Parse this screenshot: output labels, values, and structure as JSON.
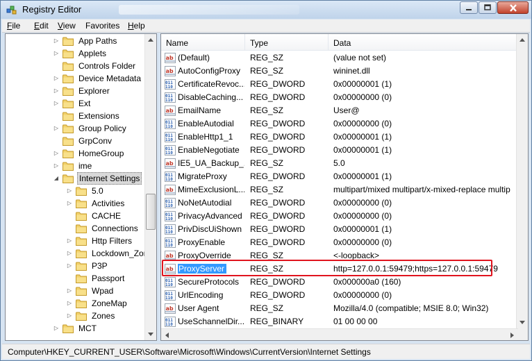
{
  "window": {
    "title": "Registry Editor"
  },
  "menu": [
    {
      "label": "File",
      "ul": "F",
      "rest": "ile"
    },
    {
      "label": "Edit",
      "ul": "E",
      "rest": "dit"
    },
    {
      "label": "View",
      "ul": "V",
      "rest": "iew"
    },
    {
      "label": "Favorites",
      "ul": "",
      "rest": "Favorites"
    },
    {
      "label": "Help",
      "ul": "H",
      "rest": "elp"
    }
  ],
  "tree": [
    {
      "label": "App Paths",
      "level": 0,
      "expander": "collapsed"
    },
    {
      "label": "Applets",
      "level": 0,
      "expander": "collapsed"
    },
    {
      "label": "Controls Folder",
      "level": 0,
      "expander": "none"
    },
    {
      "label": "Device Metadata",
      "level": 0,
      "expander": "collapsed"
    },
    {
      "label": "Explorer",
      "level": 0,
      "expander": "collapsed"
    },
    {
      "label": "Ext",
      "level": 0,
      "expander": "collapsed"
    },
    {
      "label": "Extensions",
      "level": 0,
      "expander": "none"
    },
    {
      "label": "Group Policy",
      "level": 0,
      "expander": "collapsed"
    },
    {
      "label": "GrpConv",
      "level": 0,
      "expander": "none"
    },
    {
      "label": "HomeGroup",
      "level": 0,
      "expander": "collapsed"
    },
    {
      "label": "ime",
      "level": 0,
      "expander": "collapsed"
    },
    {
      "label": "Internet Settings",
      "level": 0,
      "expander": "expanded",
      "selected": true
    },
    {
      "label": "5.0",
      "level": 1,
      "expander": "collapsed"
    },
    {
      "label": "Activities",
      "level": 1,
      "expander": "collapsed"
    },
    {
      "label": "CACHE",
      "level": 1,
      "expander": "none"
    },
    {
      "label": "Connections",
      "level": 1,
      "expander": "none"
    },
    {
      "label": "Http Filters",
      "level": 1,
      "expander": "collapsed"
    },
    {
      "label": "Lockdown_Zor",
      "level": 1,
      "expander": "collapsed"
    },
    {
      "label": "P3P",
      "level": 1,
      "expander": "collapsed"
    },
    {
      "label": "Passport",
      "level": 1,
      "expander": "none"
    },
    {
      "label": "Wpad",
      "level": 1,
      "expander": "collapsed"
    },
    {
      "label": "ZoneMap",
      "level": 1,
      "expander": "collapsed"
    },
    {
      "label": "Zones",
      "level": 1,
      "expander": "collapsed"
    },
    {
      "label": "MCT",
      "level": 0,
      "expander": "collapsed"
    }
  ],
  "columns": [
    "Name",
    "Type",
    "Data"
  ],
  "values": [
    {
      "icon": "string-value-icon",
      "name": "(Default)",
      "type": "REG_SZ",
      "data": "(value not set)"
    },
    {
      "icon": "string-value-icon",
      "name": "AutoConfigProxy",
      "type": "REG_SZ",
      "data": "wininet.dll"
    },
    {
      "icon": "binary-value-icon",
      "name": "CertificateRevoc...",
      "type": "REG_DWORD",
      "data": "0x00000001 (1)"
    },
    {
      "icon": "binary-value-icon",
      "name": "DisableCaching...",
      "type": "REG_DWORD",
      "data": "0x00000000 (0)"
    },
    {
      "icon": "string-value-icon",
      "name": "EmailName",
      "type": "REG_SZ",
      "data": "User@"
    },
    {
      "icon": "binary-value-icon",
      "name": "EnableAutodial",
      "type": "REG_DWORD",
      "data": "0x00000000 (0)"
    },
    {
      "icon": "binary-value-icon",
      "name": "EnableHttp1_1",
      "type": "REG_DWORD",
      "data": "0x00000001 (1)"
    },
    {
      "icon": "binary-value-icon",
      "name": "EnableNegotiate",
      "type": "REG_DWORD",
      "data": "0x00000001 (1)"
    },
    {
      "icon": "string-value-icon",
      "name": "IE5_UA_Backup_...",
      "type": "REG_SZ",
      "data": "5.0"
    },
    {
      "icon": "binary-value-icon",
      "name": "MigrateProxy",
      "type": "REG_DWORD",
      "data": "0x00000001 (1)"
    },
    {
      "icon": "string-value-icon",
      "name": "MimeExclusionL...",
      "type": "REG_SZ",
      "data": "multipart/mixed multipart/x-mixed-replace multip"
    },
    {
      "icon": "binary-value-icon",
      "name": "NoNetAutodial",
      "type": "REG_DWORD",
      "data": "0x00000000 (0)"
    },
    {
      "icon": "binary-value-icon",
      "name": "PrivacyAdvanced",
      "type": "REG_DWORD",
      "data": "0x00000000 (0)"
    },
    {
      "icon": "binary-value-icon",
      "name": "PrivDiscUiShown",
      "type": "REG_DWORD",
      "data": "0x00000001 (1)"
    },
    {
      "icon": "binary-value-icon",
      "name": "ProxyEnable",
      "type": "REG_DWORD",
      "data": "0x00000000 (0)"
    },
    {
      "icon": "string-value-icon",
      "name": "ProxyOverride",
      "type": "REG_SZ",
      "data": "<-loopback>"
    },
    {
      "icon": "string-value-icon",
      "name": "ProxyServer",
      "type": "REG_SZ",
      "data": "http=127.0.0.1:59479;https=127.0.0.1:59479",
      "selected": true
    },
    {
      "icon": "binary-value-icon",
      "name": "SecureProtocols",
      "type": "REG_DWORD",
      "data": "0x000000a0 (160)"
    },
    {
      "icon": "binary-value-icon",
      "name": "UrlEncoding",
      "type": "REG_DWORD",
      "data": "0x00000000 (0)"
    },
    {
      "icon": "string-value-icon",
      "name": "User Agent",
      "type": "REG_SZ",
      "data": "Mozilla/4.0 (compatible; MSIE 8.0; Win32)"
    },
    {
      "icon": "binary-value-icon",
      "name": "UseSchannelDir...",
      "type": "REG_BINARY",
      "data": "01 00 00 00"
    }
  ],
  "status": "Computer\\HKEY_CURRENT_USER\\Software\\Microsoft\\Windows\\CurrentVersion\\Internet Settings",
  "colors": {
    "selection": "#3399ff",
    "highlight_box": "#e0141e",
    "close_button": "#c2432d"
  }
}
